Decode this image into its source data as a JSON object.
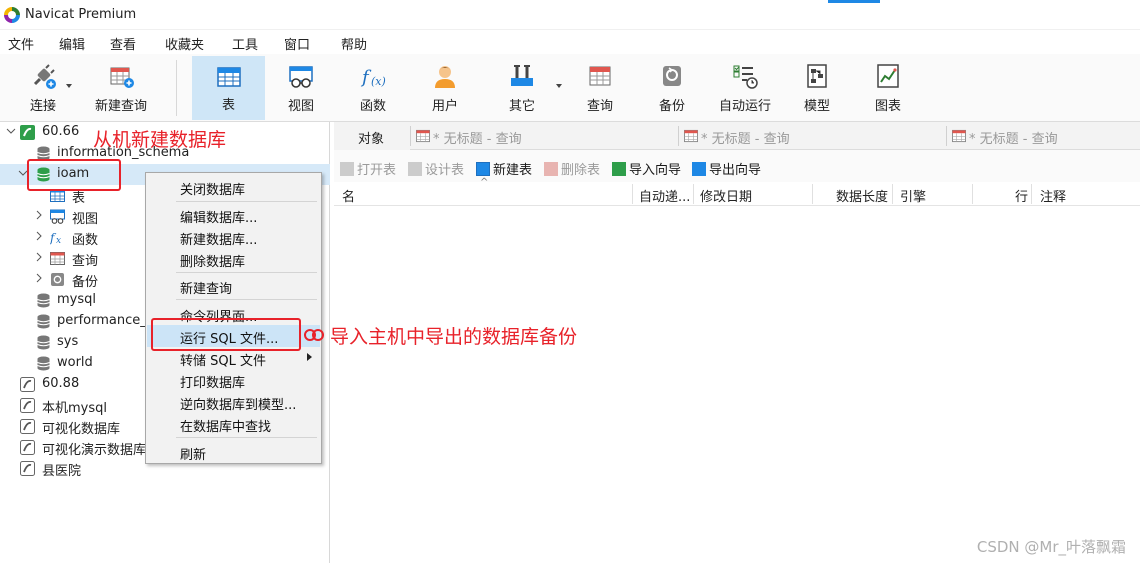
{
  "window": {
    "title": "Navicat Premium"
  },
  "menubar": [
    "文件",
    "编辑",
    "查看",
    "收藏夹",
    "工具",
    "窗口",
    "帮助"
  ],
  "toolbar": {
    "items": [
      {
        "label": "连接",
        "icon": "plug-icon"
      },
      {
        "label": "新建查询",
        "icon": "new-query-icon"
      },
      {
        "label": "表",
        "icon": "table-icon",
        "active": true
      },
      {
        "label": "视图",
        "icon": "view-icon"
      },
      {
        "label": "函数",
        "icon": "function-icon"
      },
      {
        "label": "用户",
        "icon": "user-icon"
      },
      {
        "label": "其它",
        "icon": "tools-icon"
      },
      {
        "label": "查询",
        "icon": "query-icon"
      },
      {
        "label": "备份",
        "icon": "backup-icon"
      },
      {
        "label": "自动运行",
        "icon": "schedule-icon"
      },
      {
        "label": "模型",
        "icon": "model-icon"
      },
      {
        "label": "图表",
        "icon": "chart-icon"
      }
    ]
  },
  "navtree": {
    "rows": [
      {
        "text": "60.66",
        "type": "connection-open"
      },
      {
        "text": "information_schema",
        "type": "database"
      },
      {
        "text": "ioam",
        "type": "database-open"
      },
      {
        "text": "表",
        "type": "tables"
      },
      {
        "text": "视图",
        "type": "views"
      },
      {
        "text": "函数",
        "type": "functions"
      },
      {
        "text": "查询",
        "type": "queries"
      },
      {
        "text": "备份",
        "type": "backups"
      },
      {
        "text": "mysql",
        "type": "database"
      },
      {
        "text": "performance_s",
        "type": "database"
      },
      {
        "text": "sys",
        "type": "database"
      },
      {
        "text": "world",
        "type": "database"
      },
      {
        "text": "60.88",
        "type": "connection"
      },
      {
        "text": "本机mysql",
        "type": "connection"
      },
      {
        "text": "可视化数据库",
        "type": "connection"
      },
      {
        "text": "可视化演示数据库",
        "type": "connection"
      },
      {
        "text": "县医院",
        "type": "connection"
      }
    ]
  },
  "tabs": {
    "objects": "对象",
    "query_tabs": [
      "* 无标题 - 查询",
      "* 无标题 - 查询",
      "* 无标题 - 查询"
    ]
  },
  "object_toolbar": [
    "打开表",
    "设计表",
    "新建表",
    "删除表",
    "导入向导",
    "导出向导"
  ],
  "grid": {
    "columns": [
      "名",
      "自动递...",
      "修改日期",
      "数据长度",
      "引擎",
      "行",
      "注释"
    ]
  },
  "context_menu": {
    "items": [
      "关闭数据库",
      "编辑数据库...",
      "新建数据库...",
      "删除数据库",
      "新建查询",
      "命令列界面...",
      "运行 SQL 文件...",
      "转储 SQL 文件",
      "打印数据库",
      "逆向数据库到模型...",
      "在数据库中查找",
      "刷新"
    ]
  },
  "annotations": {
    "new_db_note": "从机新建数据库",
    "import_note": "导入主机中导出的数据库备份"
  },
  "watermark": "CSDN @Mr_叶落飘霜",
  "colors": {
    "annotation": "#e8222a",
    "accent": "#1e88e5",
    "selection": "#cce4f7"
  }
}
